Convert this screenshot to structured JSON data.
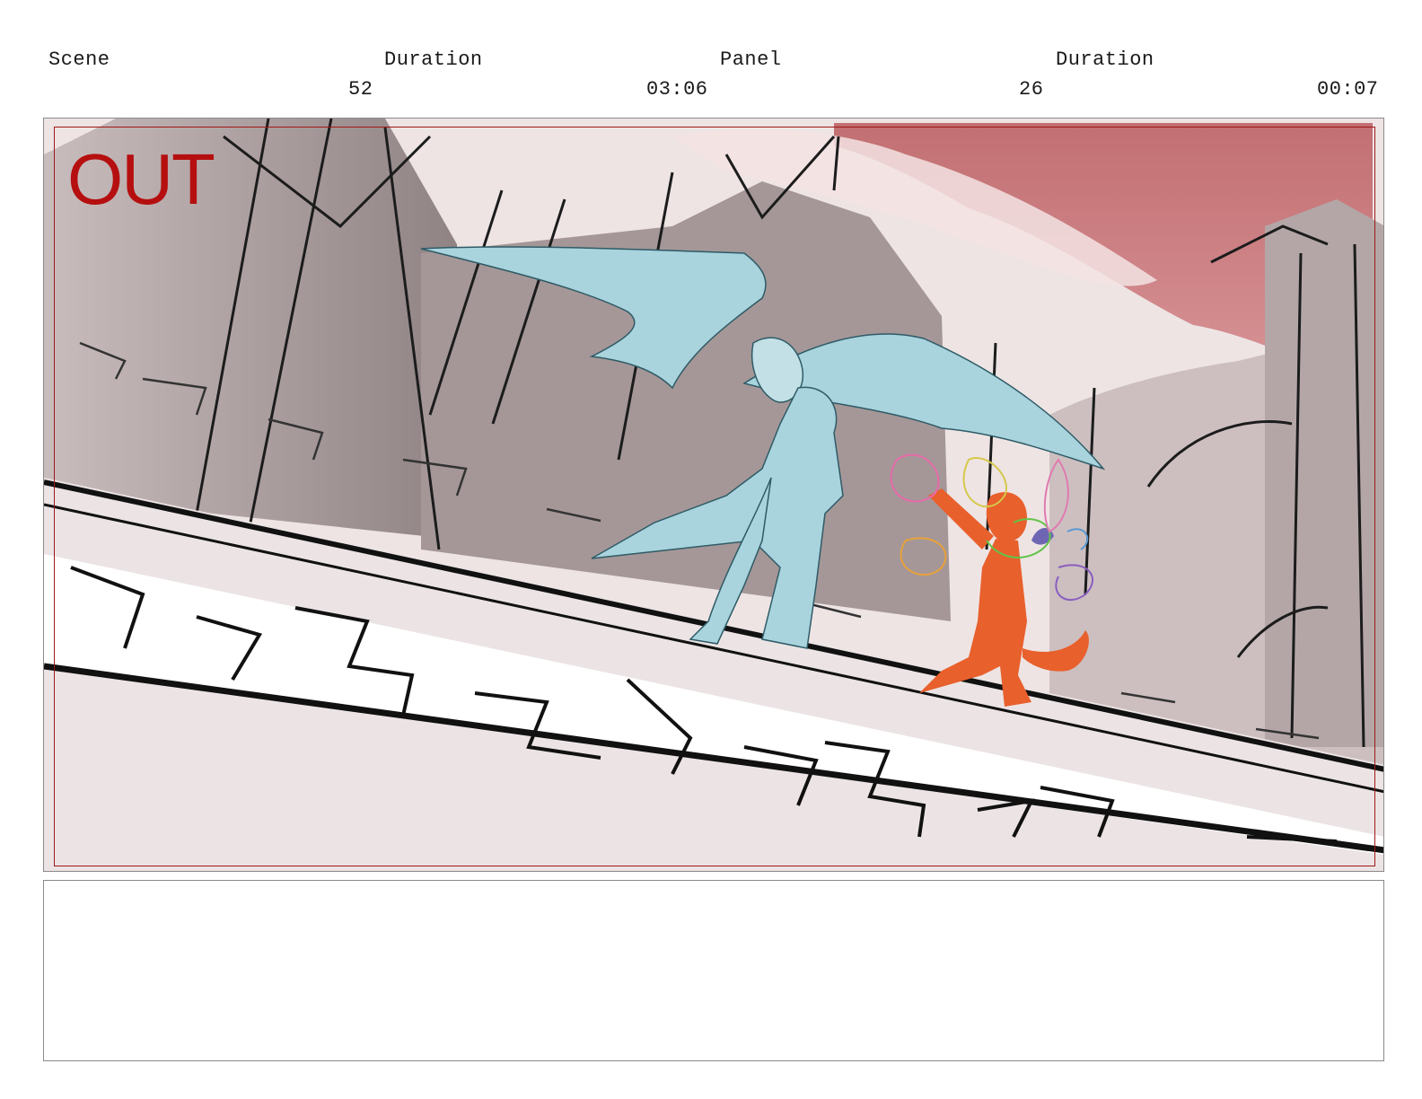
{
  "header": {
    "scene_label": "Scene",
    "scene_duration_label": "Duration",
    "panel_label": "Panel",
    "panel_duration_label": "Duration",
    "scene_number": "52",
    "scene_duration": "03:06",
    "panel_number": "26",
    "panel_duration": "00:07"
  },
  "panel": {
    "overlay_text": "OUT",
    "overlay_color": "#b50f0f",
    "sky_color": "#c87a7c",
    "demon_color": "#a9d3dd",
    "imp_color": "#e8602c"
  },
  "notes": {
    "text": ""
  }
}
